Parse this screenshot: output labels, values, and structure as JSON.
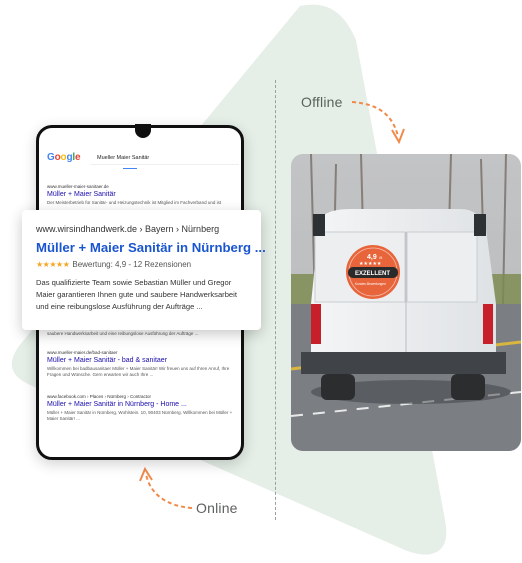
{
  "labels": {
    "offline": "Offline",
    "online": "Online"
  },
  "phone": {
    "logo": "Google",
    "search_query": "Mueller Maier Sanitär",
    "results": [
      {
        "url": "www.mueller-maier-sanitaer.de",
        "title": "Müller + Maier Sanitär",
        "desc": "Der Meisterbetrieb für Sanitär- und Heizungstechnik ist Mitglied im Fachverband und ist"
      },
      {
        "url": "www.mueller-maier.de/bad-sanitaer",
        "title": "Müller + Maier Sanitär - bad & sanitaer",
        "desc": "Willkommen bei badbausanitaer Müller + Maier Sanitär! Wir freuen uns auf Ihren Anruf, Ihre Fragen und Wünsche. Gern erwarten wir auch Ihre ..."
      },
      {
        "url": "www.facebook.com › Places › Nürnberg › Contractor",
        "title": "Müller + Maier Sanitär in Nürnberg - Home ...",
        "desc": "Müller + Maier Sanitär in Nürnberg, Wohlstein. 10, 90403 Nürnberg. Willkommen bei Müller + Maier Sanitär! ..."
      }
    ],
    "peek_text": "saubere Handwerksarbeit und eine reibungslose Ausführung der Aufträge ..."
  },
  "card": {
    "url": "www.wirsindhandwerk.de › Bayern › Nürnberg",
    "title": "Müller + Maier Sanitär in Nürnberg ...",
    "stars": "★★★★★",
    "rating_text": "Bewertung: 4,9 - 12 Rezensionen",
    "desc": "Das qualifizierte Team sowie Sebastian Müller und Gregor Maier garantieren Ihnen gute und saubere Handwerksarbeit und eine reibungslose Ausführung der Aufträge ..."
  },
  "van_sticker": {
    "score": "4,9",
    "score_suffix": "/5",
    "stars": "★★★★★",
    "badge": "EXZELLENT",
    "sub": "Kunden-Bewertungen"
  },
  "colors": {
    "triangle": "#e5eee7",
    "arrow": "#f08a4b",
    "link": "#1a55d0",
    "star": "#f5a623",
    "sticker": "#e8643a"
  }
}
